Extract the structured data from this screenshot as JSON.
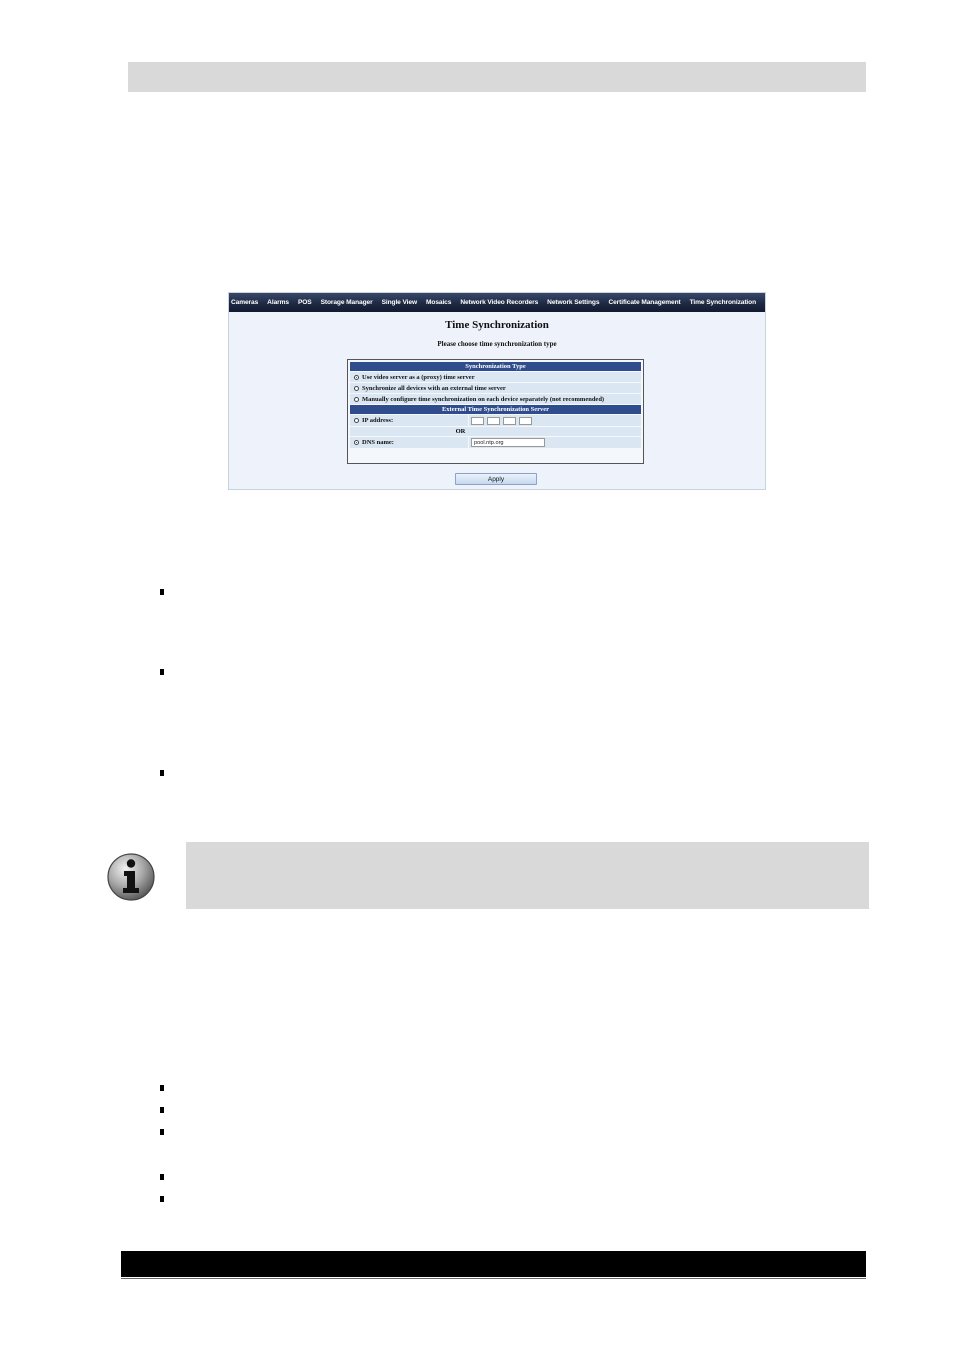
{
  "screenshot": {
    "nav_items": [
      "Cameras",
      "Alarms",
      "POS",
      "Storage Manager",
      "Single View",
      "Mosaics",
      "Network Video Recorders",
      "Network Settings",
      "Certificate Management",
      "Time Synchronization"
    ],
    "title": "Time Synchronization",
    "subtitle": "Please choose time synchronization type",
    "sync_type": {
      "header": "Synchronization Type",
      "options": [
        {
          "label": "Use video server as a (proxy) time server",
          "selected": true
        },
        {
          "label": "Synchronize all devices with an external time server",
          "selected": false
        },
        {
          "label": "Manually configure time synchronization on each device separately (not recommended)",
          "selected": false
        }
      ]
    },
    "external_server": {
      "header": "External Time Synchronization Server",
      "ip_label": "IP address:",
      "ip_octets": [
        "",
        "",
        "",
        ""
      ],
      "or_label": "OR",
      "dns_label": "DNS name:",
      "dns_value": "pool.ntp.org"
    },
    "apply_label": "Apply"
  },
  "icons": {
    "note": "info-icon"
  }
}
